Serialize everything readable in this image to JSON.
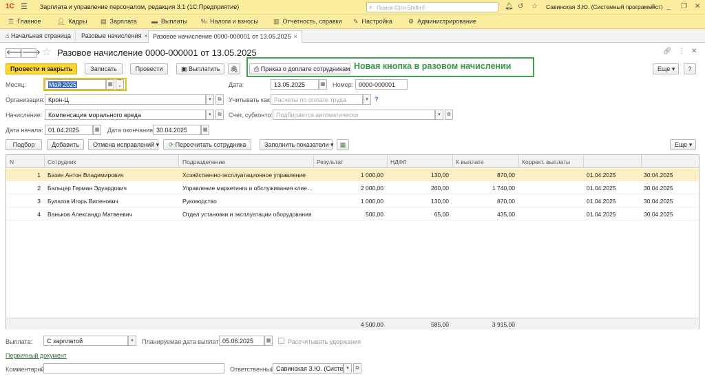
{
  "titlebar": {
    "logo": "1С",
    "title": "Зарплата и управление персоналом, редакция 3.1  (1С:Предприятие)",
    "search_placeholder": "Поиск Ctrl+Shift+F",
    "user": "Савинская З.Ю. (Системный программист)"
  },
  "sections": [
    "Главное",
    "Кадры",
    "Зарплата",
    "Выплаты",
    "Налоги и взносы",
    "Отчетность, справки",
    "Настройка",
    "Администрирование"
  ],
  "tabs": [
    {
      "label": "Начальная страница"
    },
    {
      "label": "Разовые начисления",
      "close": "×"
    },
    {
      "label": "Разовое начисление 0000-000001 от 13.05.2025",
      "close": "×"
    }
  ],
  "document": {
    "title": "Разовое начисление 0000-000001 от 13.05.2025"
  },
  "toolbar": {
    "post_close": "Провести и закрыть",
    "save": "Записать",
    "post": "Провести",
    "pay": "Выплатить",
    "order": "Приказ о доплате сотрудникам",
    "more": "Еще",
    "help": "?"
  },
  "annotation": "Новая кнопка в разовом начислении",
  "form": {
    "month_label": "Месяц:",
    "month_value": "Май 2025",
    "date_label": "Дата:",
    "date_value": "13.05.2025",
    "number_label": "Номер:",
    "number_value": "0000-000001",
    "org_label": "Организация:",
    "org_value": "Крон-Ц",
    "consider_label": "Учитывать как:",
    "consider_placeholder": "Расчеты по оплате труда",
    "accrual_label": "Начисление:",
    "accrual_value": "Компенсация морального вреда",
    "account_label": "Счет, субконто:",
    "account_placeholder": "Подбирается автоматически",
    "start_label": "Дата начала:",
    "start_value": "01.04.2025",
    "end_label": "Дата окончания:",
    "end_value": "30.04.2025"
  },
  "grid_toolbar": {
    "pick": "Подбор",
    "add": "Добавить",
    "cancel_fix": "Отмена исправлений",
    "recalc": "Пересчитать сотрудника",
    "fill": "Заполнить показатели",
    "more": "Еще"
  },
  "table": {
    "headers": [
      "N",
      "Сотрудник",
      "Подразделение",
      "Результат",
      "НДФЛ",
      "К выплате",
      "Коррект. выплаты"
    ],
    "rows": [
      [
        "1",
        "Базин Антон Владимирович",
        "Хозяйственно-эксплуатационное управление",
        "1 000,00",
        "130,00",
        "870,00",
        "",
        "01.04.2025",
        "30.04.2025"
      ],
      [
        "2",
        "Бальцер Герман Эдуардович",
        "Управление маркетинга и обслуживания клие…",
        "2 000,00",
        "260,00",
        "1 740,00",
        "",
        "01.04.2025",
        "30.04.2025"
      ],
      [
        "3",
        "Булатов Игорь Виленович",
        "Руководство",
        "1 000,00",
        "130,00",
        "870,00",
        "",
        "01.04.2025",
        "30.04.2025"
      ],
      [
        "4",
        "Ваньков Александр Матвеевич",
        "Отдел установки и эксплуатации оборудования",
        "500,00",
        "65,00",
        "435,00",
        "",
        "01.04.2025",
        "30.04.2025"
      ]
    ],
    "totals": {
      "result": "4 500,00",
      "ndfl": "585,00",
      "payout": "3 915,00"
    }
  },
  "footer": {
    "payout_label": "Выплата:",
    "payout_value": "С зарплатой",
    "planned_label": "Планируемая дата выплаты:",
    "planned_value": "05.06.2025",
    "deductions_label": "Рассчитывать удержания",
    "primary_doc": "Первичный документ",
    "comment_label": "Комментарий:",
    "responsible_label": "Ответственный:",
    "responsible_value": "Савинская З.Ю. (Систем"
  },
  "colors": {
    "accent": "#fdd62a",
    "annotation": "#2e9b45",
    "header_bg": "#fbed9e"
  }
}
